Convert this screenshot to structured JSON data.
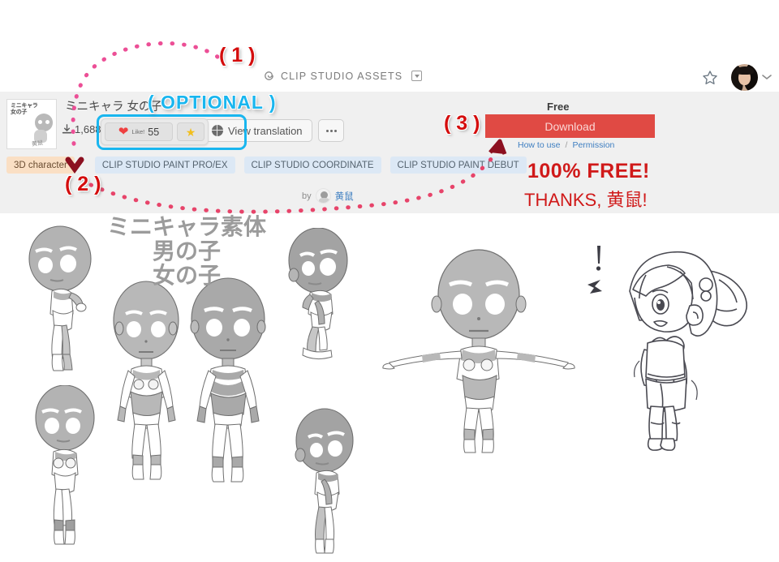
{
  "header": {
    "brand": "CLIP STUDIO ASSETS",
    "brand_icon": "spiral-logo-icon",
    "brand_caret_icon": "caret-down-boxed-icon",
    "favorite_icon": "star-outline-icon",
    "avatar_name": "user-avatar",
    "user_caret_icon": "chevron-down-icon"
  },
  "asset": {
    "thumbnail_text_line1": "ミニキャラ",
    "thumbnail_text_line2": "女の子",
    "thumbnail_signature": "黄鼠",
    "title": "ミニキャラ 女の子",
    "download_icon": "download-icon",
    "download_count": "1,688",
    "like_icon": "heart-icon",
    "like_label": "Like!",
    "like_count": "55",
    "star_icon": "star-filled-icon",
    "translate_icon": "globe-icon",
    "translate_label": "View translation",
    "more_icon": "ellipsis-icon",
    "tags": [
      {
        "label": "3D character",
        "kind": "category"
      },
      {
        "label": "CLIP STUDIO PAINT PRO/EX",
        "kind": "app"
      },
      {
        "label": "CLIP STUDIO COORDINATE",
        "kind": "app"
      },
      {
        "label": "CLIP STUDIO PAINT DEBUT",
        "kind": "app"
      }
    ],
    "by_label": "by",
    "author": "黄鼠",
    "author_avatar": "author-avatar"
  },
  "purchase": {
    "price": "Free",
    "download_button": "Download",
    "how_to_use": "How to use",
    "link_separator": "/",
    "permission": "Permission"
  },
  "annotations": {
    "marker_1": "( 1 )",
    "marker_2": "( 2 )",
    "marker_3": "( 3 )",
    "optional": "( OPTIONAL )",
    "free_shout": "100% FREE!",
    "thanks": "THANKS, 黄鼠!",
    "accent_blue": "#19b6ef",
    "accent_red": "#d40d0d",
    "arrow_pink": "#f07ab0",
    "arrow_head_red": "#8c1020"
  },
  "illustration": {
    "title_line1": "ミニキャラ素体",
    "title_line2": "男の子",
    "title_line3": "女の子"
  }
}
